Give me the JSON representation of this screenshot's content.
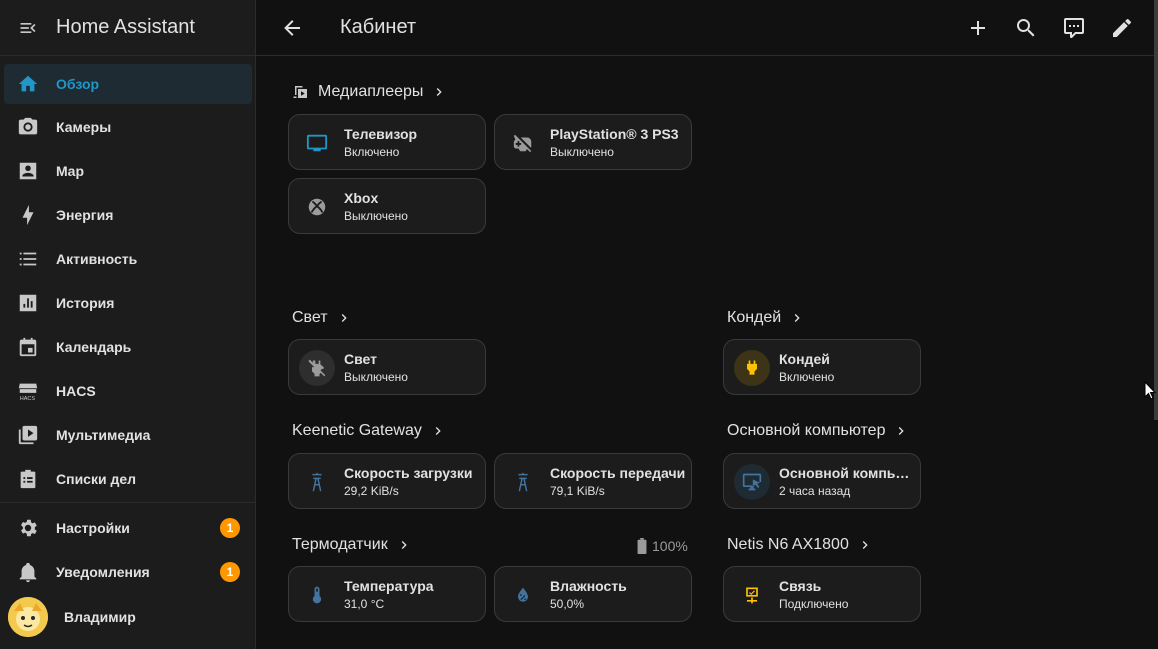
{
  "sidebar": {
    "title": "Home Assistant",
    "items": [
      {
        "label": "Обзор",
        "icon": "home-icon"
      },
      {
        "label": "Камеры",
        "icon": "camera-icon"
      },
      {
        "label": "Map",
        "icon": "map-icon"
      },
      {
        "label": "Энергия",
        "icon": "lightning-icon"
      },
      {
        "label": "Активность",
        "icon": "list-icon"
      },
      {
        "label": "История",
        "icon": "chart-icon"
      },
      {
        "label": "Календарь",
        "icon": "calendar-icon"
      },
      {
        "label": "HACS",
        "icon": "hacs-icon"
      },
      {
        "label": "Мультимедиа",
        "icon": "play-box-icon"
      },
      {
        "label": "Списки дел",
        "icon": "clipboard-list-icon"
      }
    ],
    "settings": {
      "label": "Настройки",
      "badge": "1"
    },
    "notifications": {
      "label": "Уведомления",
      "badge": "1"
    },
    "user": {
      "name": "Владимир"
    }
  },
  "topbar": {
    "title": "Кабинет"
  },
  "sections": {
    "media": {
      "title": "Медиаплееры"
    },
    "light": {
      "title": "Свет"
    },
    "ac": {
      "title": "Кондей"
    },
    "keenetic": {
      "title": "Keenetic Gateway"
    },
    "pc": {
      "title": "Основной компьютер"
    },
    "thermo": {
      "title": "Термодатчик",
      "battery": "100%"
    },
    "netis": {
      "title": "Netis N6 AX1800"
    }
  },
  "cards": {
    "tv": {
      "name": "Телевизор",
      "state": "Включено"
    },
    "ps3": {
      "name": "PlayStation® 3 PS3",
      "state": "Выключено"
    },
    "xbox": {
      "name": "Xbox",
      "state": "Выключено"
    },
    "light": {
      "name": "Свет",
      "state": "Выключено"
    },
    "ac": {
      "name": "Кондей",
      "state": "Включено"
    },
    "download": {
      "name": "Скорость загрузки",
      "state": "29,2 KiB/s"
    },
    "upload": {
      "name": "Скорость передачи",
      "state": "79,1 KiB/s"
    },
    "pc": {
      "name": "Основной компь…",
      "state": "2 часа назад"
    },
    "temp": {
      "name": "Температура",
      "state": "31,0 °C"
    },
    "humidity": {
      "name": "Влажность",
      "state": "50,0%"
    },
    "link": {
      "name": "Связь",
      "state": "Подключено"
    }
  },
  "colors": {
    "accent": "#2196c7",
    "badge": "#ff9800",
    "on_yellow": "#ffc107",
    "icon_blue": "#44739e"
  }
}
